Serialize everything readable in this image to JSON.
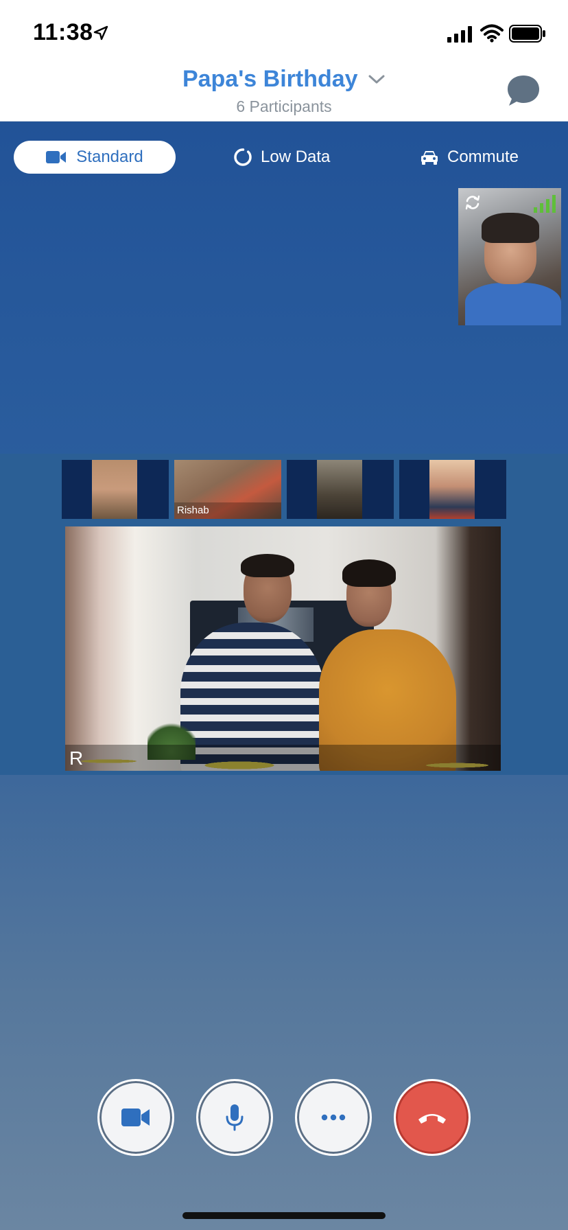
{
  "status_bar": {
    "time": "11:38"
  },
  "header": {
    "title": "Papa's Birthday",
    "participants": "6 Participants"
  },
  "modes": {
    "standard": "Standard",
    "low_data": "Low Data",
    "commute": "Commute",
    "selected": "Standard"
  },
  "thumbnails": [
    {
      "name": ""
    },
    {
      "name": "Rishab"
    },
    {
      "name": ""
    },
    {
      "name": ""
    }
  ],
  "main_video": {
    "initial": "R"
  },
  "icons": {
    "status": [
      "location-arrow-icon",
      "cellular-signal-icon",
      "wifi-icon",
      "battery-icon"
    ],
    "header": [
      "chevron-down-icon",
      "chat-bubble-icon"
    ],
    "modes": [
      "video-camera-icon",
      "low-data-icon",
      "car-icon"
    ],
    "self_view": [
      "rotate-camera-icon",
      "signal-strength-icon"
    ],
    "controls": [
      "video-camera-icon",
      "microphone-icon",
      "more-icon",
      "end-call-icon"
    ]
  },
  "colors": {
    "accent": "#3d85d8",
    "end_call": "#e2574c",
    "background_top": "#1f4f95",
    "signal_green": "#5fbf3a"
  }
}
